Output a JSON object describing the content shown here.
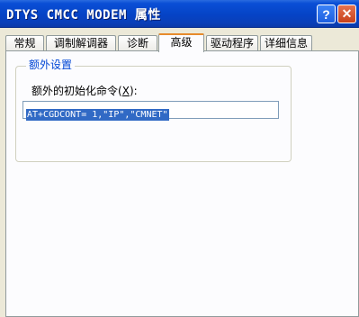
{
  "window": {
    "title": "DTYS CMCC MODEM 属性",
    "help_label": "?",
    "close_label": "✕"
  },
  "tabs": [
    {
      "label": "常规"
    },
    {
      "label": "调制解调器"
    },
    {
      "label": "诊断"
    },
    {
      "label": "高级"
    },
    {
      "label": "驱动程序"
    },
    {
      "label": "详细信息"
    }
  ],
  "active_tab": "高级",
  "extra_settings": {
    "group_label": "额外设置",
    "init_command_label": "额外的初始化命令",
    "init_command_mnemonic": "X",
    "init_command_value": "AT+CGDCONT= 1,\"IP\",\"CMNET\""
  },
  "colors": {
    "titlebar": "#0543c6",
    "group_label": "#0046d5",
    "selection": "#316ac5",
    "active_tab_accent": "#e68b2c"
  }
}
